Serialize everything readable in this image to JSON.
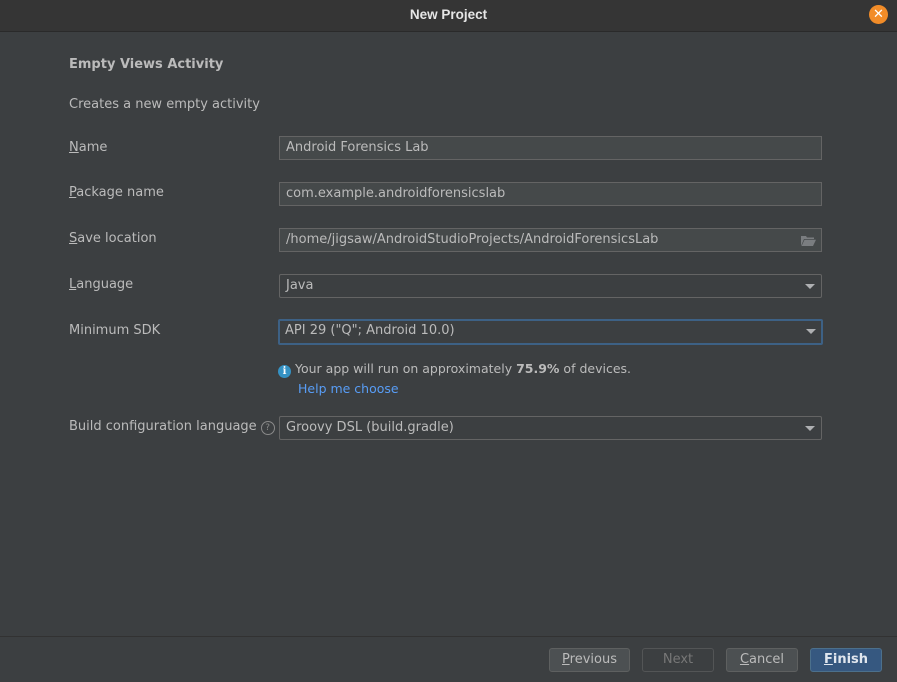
{
  "window": {
    "title": "New Project",
    "close_icon": "close-icon"
  },
  "template": {
    "heading": "Empty Views Activity",
    "description": "Creates a new empty activity"
  },
  "form": {
    "name": {
      "label_mnemonic": "N",
      "label_rest": "ame",
      "value": "Android Forensics Lab"
    },
    "package_name": {
      "label_mnemonic": "P",
      "label_rest": "ackage name",
      "value": "com.example.androidforensicslab"
    },
    "save_location": {
      "label_mnemonic": "S",
      "label_rest": "ave location",
      "value": "/home/jigsaw/AndroidStudioProjects/AndroidForensicsLab",
      "icon": "folder-icon"
    },
    "language": {
      "label_mnemonic": "L",
      "label_rest": "anguage",
      "value": "Java"
    },
    "minimum_sdk": {
      "label": "Minimum SDK",
      "value": "API 29 (\"Q\"; Android 10.0)"
    },
    "sdk_info": {
      "prefix": "Your app will run on approximately ",
      "percentage": "75.9%",
      "suffix": " of devices.",
      "help_link": "Help me choose"
    },
    "build_config": {
      "label": "Build configuration language",
      "help_icon": "?",
      "value": "Groovy DSL (build.gradle)"
    }
  },
  "footer": {
    "previous": {
      "mnemonic": "P",
      "rest": "revious"
    },
    "next": {
      "label": "Next"
    },
    "cancel": {
      "mnemonic": "C",
      "rest": "ancel"
    },
    "finish": {
      "mnemonic": "F",
      "rest": "inish"
    }
  },
  "colors": {
    "background": "#3c3f41",
    "accent_focus": "#3d6185",
    "primary_button": "#365880",
    "link": "#589df6",
    "close_button": "#f28c28",
    "info_icon": "#3592c4"
  }
}
